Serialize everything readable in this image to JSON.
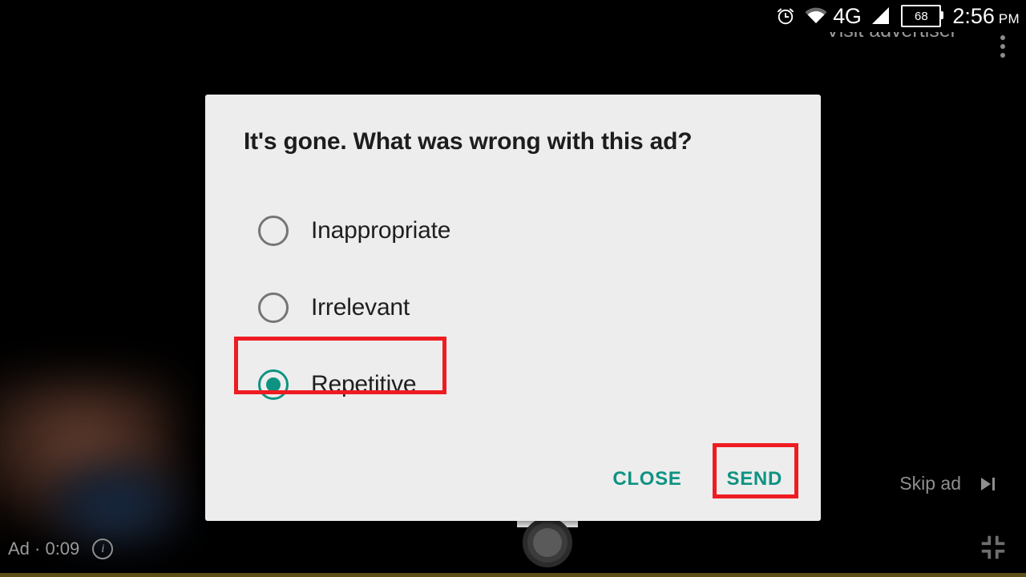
{
  "status_bar": {
    "alarm_icon": "alarm-clock-icon",
    "wifi_icon": "wifi-icon",
    "network_label": "4G",
    "signal_icon": "cellular-signal-icon",
    "battery_level": "68",
    "time": "2:56",
    "am_pm": "PM"
  },
  "player_overlay": {
    "visit_advertiser_label": "Visit advertiser",
    "overflow_menu_icon": "kebab-menu-icon",
    "ad_label": "Ad · 0:09",
    "info_icon": "info-icon",
    "info_glyph": "i",
    "skip_ad_label": "Skip ad",
    "skip_icon": "skip-next-icon",
    "fullscreen_icon": "exit-fullscreen-icon",
    "progress_percent": 0
  },
  "dialog": {
    "title": "It's gone. What was wrong with this ad?",
    "options": [
      {
        "label": "Inappropriate",
        "selected": false
      },
      {
        "label": "Irrelevant",
        "selected": false
      },
      {
        "label": "Repetitive",
        "selected": true
      }
    ],
    "close_label": "CLOSE",
    "send_label": "SEND"
  },
  "colors": {
    "accent_teal": "#0e9382",
    "highlight_red": "#ee1c22",
    "dialog_bg": "#ededed",
    "progress_yellow": "#e8cb2e"
  }
}
